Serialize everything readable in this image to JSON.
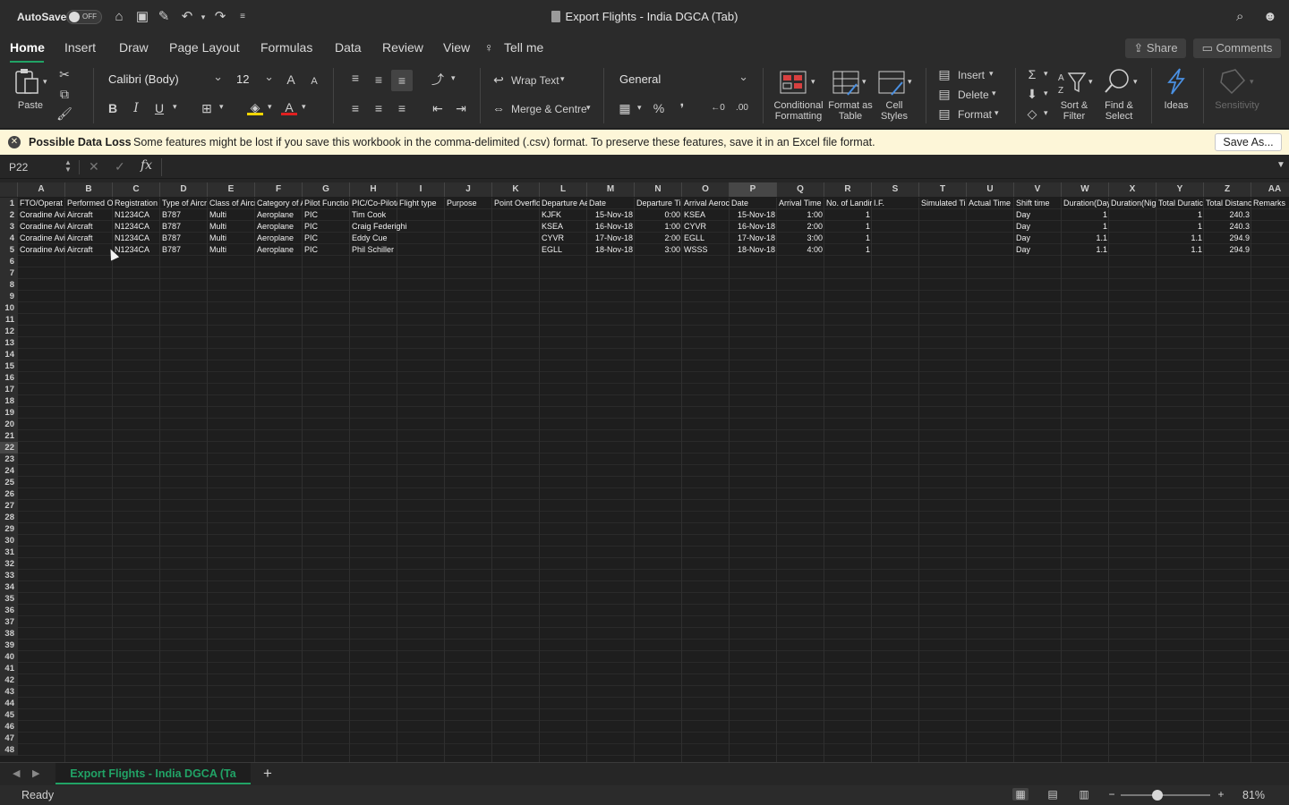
{
  "titlebar": {
    "autosave_label": "AutoSave",
    "autosave_state": "OFF",
    "doc_title": "Export Flights - India DGCA (Tab)"
  },
  "menu": {
    "tabs": [
      "Home",
      "Insert",
      "Draw",
      "Page Layout",
      "Formulas",
      "Data",
      "Review",
      "View"
    ],
    "tell_me": "Tell me",
    "share": "Share",
    "comments": "Comments"
  },
  "ribbon": {
    "paste": "Paste",
    "font_name": "Calibri (Body)",
    "font_size": "12",
    "bold": "B",
    "italic": "I",
    "underline": "U",
    "wrap_text": "Wrap Text",
    "merge_centre": "Merge & Centre",
    "number_format": "General",
    "conditional_formatting": "Conditional Formatting",
    "format_as_table": "Format as Table",
    "cell_styles": "Cell Styles",
    "insert": "Insert",
    "delete": "Delete",
    "format": "Format",
    "sort_filter": "Sort & Filter",
    "find_select": "Find & Select",
    "ideas": "Ideas",
    "sensitivity": "Sensitivity"
  },
  "message_bar": {
    "title": "Possible Data Loss",
    "text": "Some features might be lost if you save this workbook in the comma-delimited (.csv) format. To preserve these features, save it in an Excel file format.",
    "button": "Save As..."
  },
  "formula_bar": {
    "name_box": "P22",
    "fx": "fx",
    "value": ""
  },
  "sheet": {
    "columns": [
      "A",
      "B",
      "C",
      "D",
      "E",
      "F",
      "G",
      "H",
      "I",
      "J",
      "K",
      "L",
      "M",
      "N",
      "O",
      "P",
      "Q",
      "R",
      "S",
      "T",
      "U",
      "V",
      "W",
      "X",
      "Y",
      "Z",
      "AA"
    ],
    "selected_column": "P",
    "selected_row": "22",
    "row_numbers": [
      "1",
      "2",
      "3",
      "4",
      "5",
      "6",
      "7",
      "8",
      "9",
      "10",
      "11",
      "12",
      "13",
      "14",
      "15",
      "16",
      "17",
      "18",
      "19",
      "20",
      "21",
      "22",
      "23",
      "24",
      "25",
      "26",
      "27",
      "28",
      "29",
      "30",
      "31",
      "32",
      "33",
      "34",
      "35",
      "36",
      "37",
      "38",
      "39",
      "40",
      "41",
      "42",
      "43",
      "44",
      "45",
      "46",
      "47",
      "48"
    ],
    "header_row": [
      "FTO/Operat",
      "Performed O",
      "Registration",
      "Type of Aircr",
      "Class of Aircr",
      "Category of A",
      "Pilot Functio",
      "PIC/Co-Pilot/",
      "Flight type",
      "Purpose",
      "Point Overflo",
      "Departure Ae",
      "Date",
      "Departure Ti",
      "Arrival Aeroc",
      "Date",
      "Arrival Time",
      "No. of Landir",
      "I.F.",
      "Simulated Ti",
      "Actual Time",
      "Shift time",
      "Duration(Day",
      "Duration(Nig",
      "Total Duratic",
      "Total Distanc",
      "Remarks"
    ],
    "rows": [
      [
        "Coradine Avi",
        "Aircraft",
        "N1234CA",
        "B787",
        "Multi",
        "Aeroplane",
        "PIC",
        "Tim Cook",
        "",
        "",
        "",
        "KJFK",
        "15-Nov-18",
        "0:00",
        "KSEA",
        "15-Nov-18",
        "1:00",
        "1",
        "",
        "",
        "",
        "Day",
        "1",
        "",
        "1",
        "240.3",
        ""
      ],
      [
        "Coradine Avi",
        "Aircraft",
        "N1234CA",
        "B787",
        "Multi",
        "Aeroplane",
        "PIC",
        "Craig Federighi",
        "",
        "",
        "",
        "KSEA",
        "16-Nov-18",
        "1:00",
        "CYVR",
        "16-Nov-18",
        "2:00",
        "1",
        "",
        "",
        "",
        "Day",
        "1",
        "",
        "1",
        "240.3",
        ""
      ],
      [
        "Coradine Avi",
        "Aircraft",
        "N1234CA",
        "B787",
        "Multi",
        "Aeroplane",
        "PIC",
        "Eddy Cue",
        "",
        "",
        "",
        "CYVR",
        "17-Nov-18",
        "2:00",
        "EGLL",
        "17-Nov-18",
        "3:00",
        "1",
        "",
        "",
        "",
        "Day",
        "1.1",
        "",
        "1.1",
        "294.9",
        ""
      ],
      [
        "Coradine Avi",
        "Aircraft",
        "N1234CA",
        "B787",
        "Multi",
        "Aeroplane",
        "PIC",
        "Phil Schiller",
        "",
        "",
        "",
        "EGLL",
        "18-Nov-18",
        "3:00",
        "WSSS",
        "18-Nov-18",
        "4:00",
        "1",
        "",
        "",
        "",
        "Day",
        "1.1",
        "",
        "1.1",
        "294.9",
        ""
      ]
    ],
    "tab_name": "Export Flights - India DGCA (Ta"
  },
  "status": {
    "ready": "Ready",
    "zoom": "81%"
  },
  "colors": {
    "accent": "#21a366",
    "msgbar_bg": "#fdf6d8"
  }
}
